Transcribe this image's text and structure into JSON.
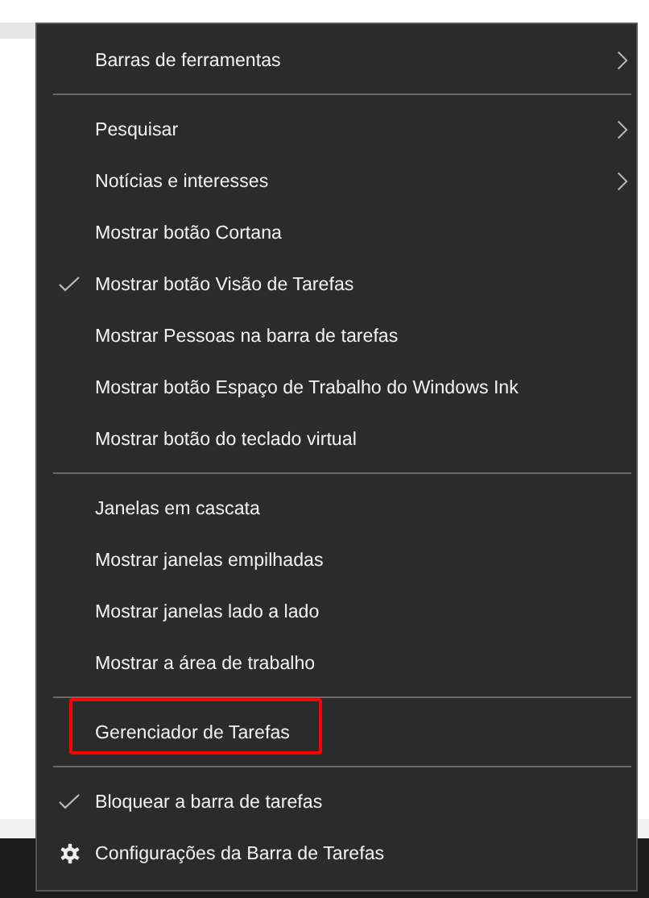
{
  "context_menu": {
    "groups": [
      {
        "items": [
          {
            "kind": "item",
            "label": "Barras de ferramentas",
            "checked": false,
            "has_submenu": true,
            "highlighted": false
          }
        ]
      },
      {
        "items": [
          {
            "kind": "item",
            "label": "Pesquisar",
            "checked": false,
            "has_submenu": true,
            "highlighted": false
          },
          {
            "kind": "item",
            "label": "Notícias e interesses",
            "checked": false,
            "has_submenu": true,
            "highlighted": false
          },
          {
            "kind": "item",
            "label": "Mostrar botão Cortana",
            "checked": false,
            "has_submenu": false,
            "highlighted": false
          },
          {
            "kind": "item",
            "label": "Mostrar botão Visão de Tarefas",
            "checked": true,
            "has_submenu": false,
            "highlighted": false
          },
          {
            "kind": "item",
            "label": "Mostrar Pessoas na barra de tarefas",
            "checked": false,
            "has_submenu": false,
            "highlighted": false
          },
          {
            "kind": "item",
            "label": "Mostrar botão Espaço de Trabalho do Windows Ink",
            "checked": false,
            "has_submenu": false,
            "highlighted": false
          },
          {
            "kind": "item",
            "label": "Mostrar botão do teclado virtual",
            "checked": false,
            "has_submenu": false,
            "highlighted": false
          }
        ]
      },
      {
        "items": [
          {
            "kind": "item",
            "label": "Janelas em cascata",
            "checked": false,
            "has_submenu": false,
            "highlighted": false
          },
          {
            "kind": "item",
            "label": "Mostrar janelas empilhadas",
            "checked": false,
            "has_submenu": false,
            "highlighted": false
          },
          {
            "kind": "item",
            "label": "Mostrar janelas lado a lado",
            "checked": false,
            "has_submenu": false,
            "highlighted": false
          },
          {
            "kind": "item",
            "label": "Mostrar a área de trabalho",
            "checked": false,
            "has_submenu": false,
            "highlighted": false
          }
        ]
      },
      {
        "items": [
          {
            "kind": "item",
            "label": "Gerenciador de Tarefas",
            "checked": false,
            "has_submenu": false,
            "highlighted": true
          }
        ]
      },
      {
        "items": [
          {
            "kind": "item",
            "label": "Bloquear a barra de tarefas",
            "checked": true,
            "has_submenu": false,
            "highlighted": false
          },
          {
            "kind": "settings",
            "label": "Configurações da Barra de Tarefas",
            "checked": false,
            "has_submenu": false,
            "highlighted": false
          }
        ]
      }
    ]
  }
}
